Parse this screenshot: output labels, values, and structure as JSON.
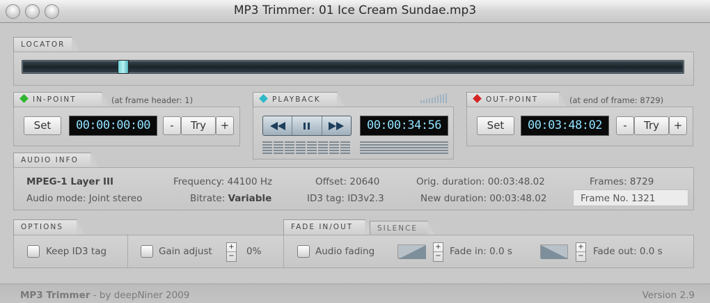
{
  "window": {
    "title": "MP3 Trimmer: 01 Ice Cream Sundae.mp3"
  },
  "locator": {
    "tab": "LOCATOR",
    "position": 0.147
  },
  "in_point": {
    "tab": "IN-POINT",
    "note": "(at frame header: 1)",
    "set": "Set",
    "time": "00:00:00:00",
    "minus": "-",
    "try": "Try",
    "plus": "+"
  },
  "playback": {
    "tab": "PLAYBACK",
    "time": "00:00:34:56",
    "rewind_icon": "rewind-icon",
    "pause_icon": "pause-icon",
    "forward_icon": "fast-forward-icon",
    "volume_icon": "volume-bars-icon"
  },
  "out_point": {
    "tab": "OUT-POINT",
    "note": "(at end of frame: 8729)",
    "set": "Set",
    "time": "00:03:48:02",
    "minus": "-",
    "try": "Try",
    "plus": "+"
  },
  "audio_info": {
    "tab": "AUDIO INFO",
    "format": "MPEG-1 Layer III",
    "audio_mode": "Audio mode: Joint stereo",
    "frequency": "Frequency: 44100 Hz",
    "bitrate_label": "Bitrate:",
    "bitrate_value": "Variable",
    "offset": "Offset: 20640",
    "id3": "ID3 tag: ID3v2.3",
    "orig_duration": "Orig. duration: 00:03:48.02",
    "new_duration": "New duration: 00:03:48.02",
    "frames": "Frames: 8729",
    "frame_no": "Frame No. 1321"
  },
  "options": {
    "tab": "OPTIONS",
    "keep_id3": "Keep ID3 tag",
    "gain_adjust": "Gain adjust",
    "gain_value": "0%"
  },
  "fade": {
    "tab": "FADE IN/OUT",
    "tab2": "SILENCE",
    "audio_fading": "Audio fading",
    "fade_in": "Fade in: 0.0 s",
    "fade_out": "Fade out: 0.0 s"
  },
  "footer": {
    "app": "MP3 Trimmer",
    "by": "- by deepNiner 2009",
    "version": "Version 2.9"
  },
  "colors": {
    "lcd_text": "#8fe1ff",
    "in_diamond": "#2fb52f",
    "play_diamond": "#2fb8c8",
    "out_diamond": "#d42323"
  }
}
